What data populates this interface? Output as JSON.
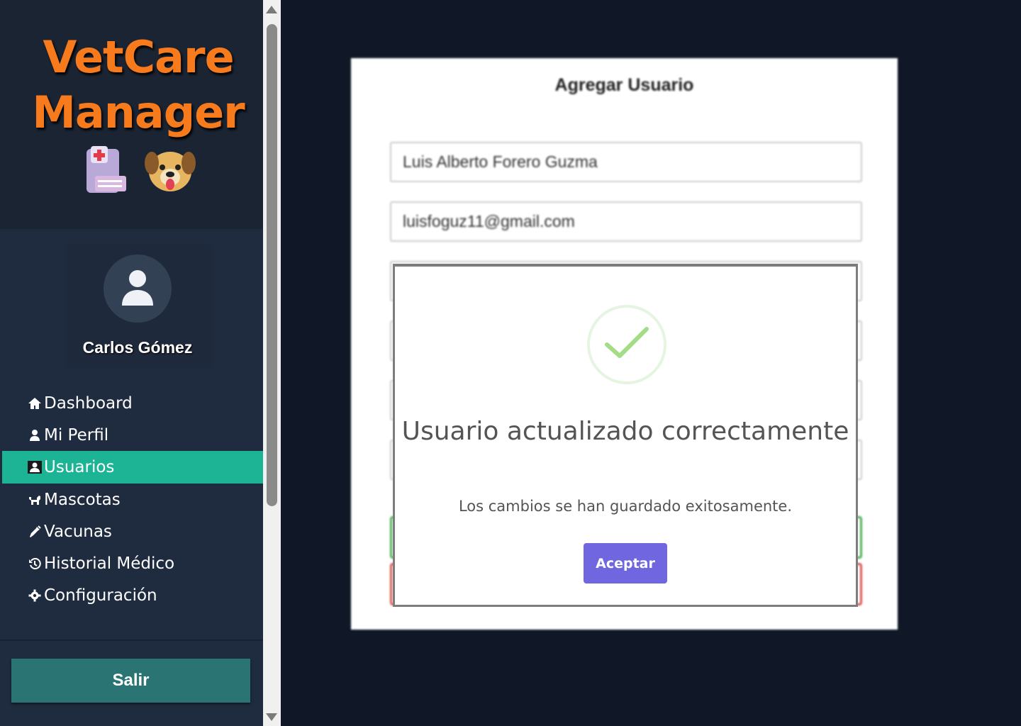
{
  "app": {
    "logo_line1": "VetCare",
    "logo_line2": "Manager",
    "brand_color": "#f77a1c"
  },
  "sidebar": {
    "user_name": "Carlos Gómez",
    "items": [
      {
        "label": "Dashboard",
        "icon": "home-icon",
        "active": false
      },
      {
        "label": "Mi Perfil",
        "icon": "user-icon",
        "active": false
      },
      {
        "label": "Usuarios",
        "icon": "id-card-icon",
        "active": true
      },
      {
        "label": "Mascotas",
        "icon": "dog-icon",
        "active": false
      },
      {
        "label": "Vacunas",
        "icon": "syringe-icon",
        "active": false
      },
      {
        "label": "Historial Médico",
        "icon": "history-icon",
        "active": false
      },
      {
        "label": "Configuración",
        "icon": "gear-icon",
        "active": false
      }
    ],
    "active_color": "#1cb495",
    "logout_label": "Salir"
  },
  "form": {
    "title": "Agregar Usuario",
    "name_value": "Luis Alberto Forero Guzma",
    "email_value": "luisfoguz11@gmail.com"
  },
  "modal": {
    "title": "Usuario actualizado correctamente",
    "message": "Los cambios se han guardado exitosamente.",
    "accept_label": "Aceptar",
    "accept_color": "#7066e0",
    "icon": "success-check-icon"
  }
}
